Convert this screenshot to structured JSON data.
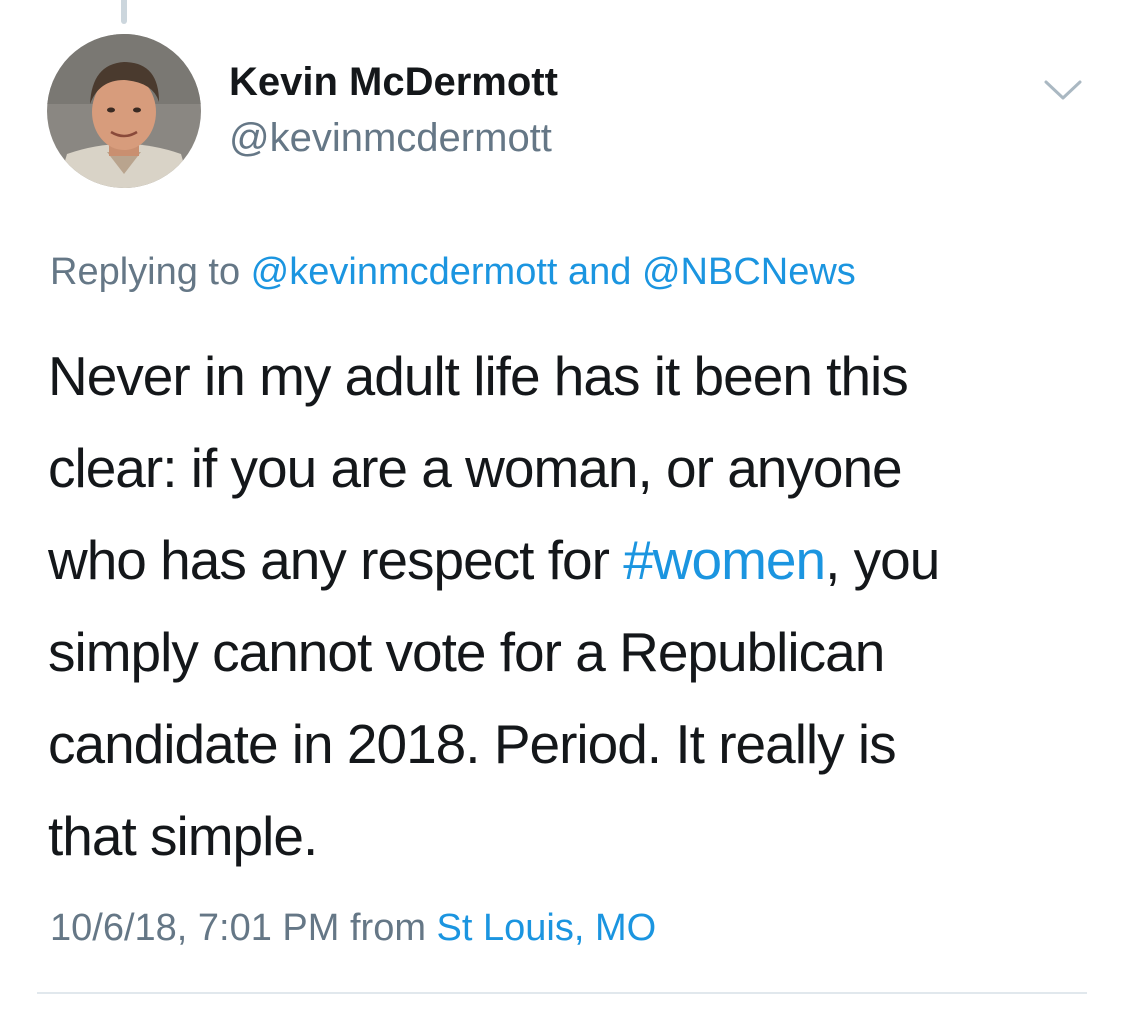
{
  "author": {
    "display_name": "Kevin McDermott",
    "handle": "@kevinmcdermott"
  },
  "reply_context": {
    "prefix": "Replying to ",
    "mention_1": "@kevinmcdermott",
    "conjunction": " and ",
    "mention_2": "@NBCNews"
  },
  "tweet": {
    "line_1": "Never in my adult life has it been this",
    "line_2": "clear: if you are a woman, or anyone",
    "line_3_before": "who has any respect for ",
    "hashtag": "#women",
    "line_3_after": ", you",
    "line_4": "simply cannot vote for a Republican",
    "line_5": "candidate in 2018. Period. It really is",
    "line_6": "that simple."
  },
  "meta": {
    "timestamp": "10/6/18, 7:01 PM",
    "from_label": " from ",
    "location": "St Louis, MO"
  },
  "icons": {
    "more_menu": "chevron-down-icon"
  },
  "colors": {
    "link": "#1b95e0",
    "secondary_text": "#657786",
    "primary_text": "#14171a"
  }
}
